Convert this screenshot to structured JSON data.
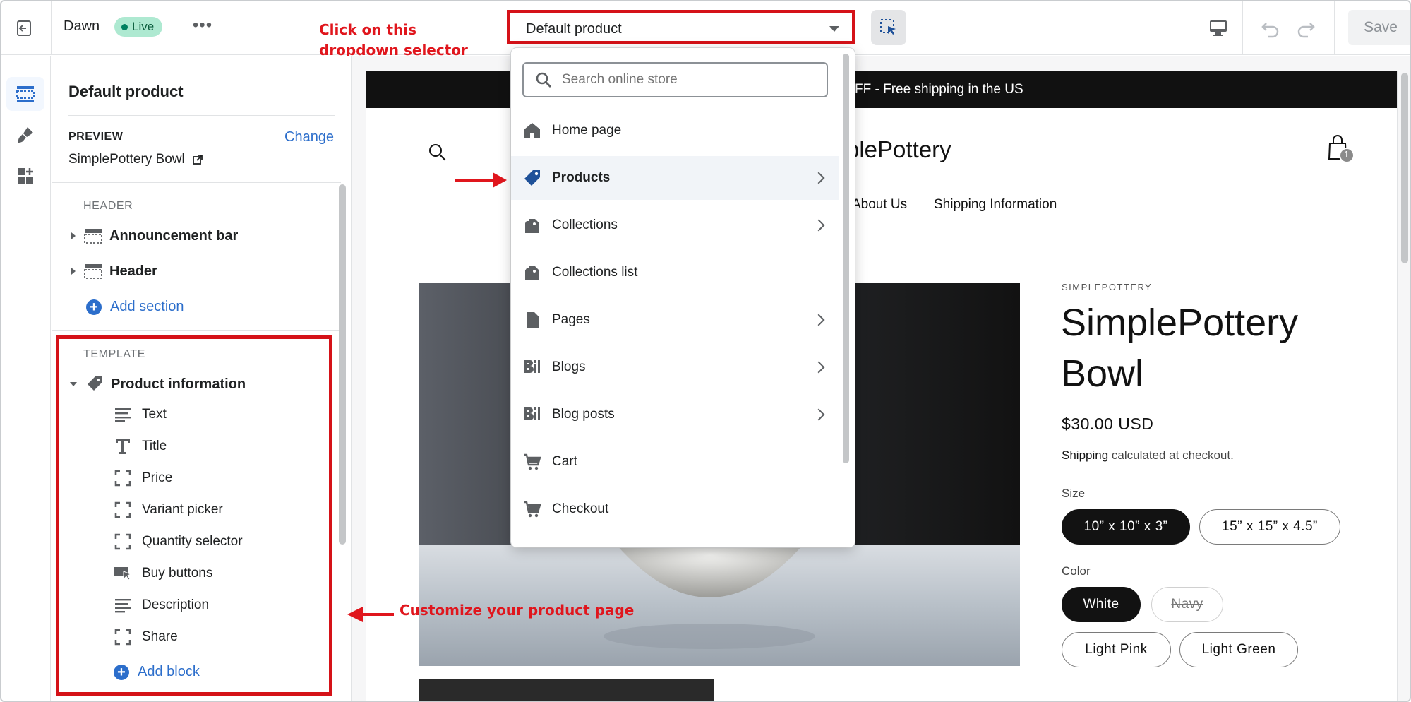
{
  "topbar": {
    "theme_name": "Dawn",
    "status_badge": "Live",
    "template_selector": "Default product",
    "save_label": "Save"
  },
  "annotations": {
    "dropdown_note": "Click on this dropdown selector",
    "sidebar_note": "Customize your product page"
  },
  "sidebar": {
    "title": "Default product",
    "preview_label": "PREVIEW",
    "change_label": "Change",
    "preview_product": "SimplePottery Bowl",
    "header_group": "HEADER",
    "header_sections": [
      "Announcement bar",
      "Header"
    ],
    "add_section": "Add section",
    "template_group": "TEMPLATE",
    "template_section": "Product information",
    "blocks": [
      {
        "label": "Text",
        "icon": "text-lines-icon"
      },
      {
        "label": "Title",
        "icon": "title-t-icon"
      },
      {
        "label": "Price",
        "icon": "dashed-square-icon"
      },
      {
        "label": "Variant picker",
        "icon": "dashed-square-icon"
      },
      {
        "label": "Quantity selector",
        "icon": "dashed-square-icon"
      },
      {
        "label": "Buy buttons",
        "icon": "buy-button-icon"
      },
      {
        "label": "Description",
        "icon": "text-lines-icon"
      },
      {
        "label": "Share",
        "icon": "dashed-square-icon"
      }
    ],
    "add_block": "Add block"
  },
  "dropdown": {
    "search_placeholder": "Search online store",
    "items": [
      {
        "label": "Home page",
        "icon": "home-icon",
        "has_children": false
      },
      {
        "label": "Products",
        "icon": "product-tag-icon",
        "has_children": true,
        "active": true
      },
      {
        "label": "Collections",
        "icon": "collection-icon",
        "has_children": true
      },
      {
        "label": "Collections list",
        "icon": "collection-icon",
        "has_children": false
      },
      {
        "label": "Pages",
        "icon": "page-icon",
        "has_children": true
      },
      {
        "label": "Blogs",
        "icon": "blog-icon",
        "has_children": true
      },
      {
        "label": "Blog posts",
        "icon": "blog-icon",
        "has_children": true
      },
      {
        "label": "Cart",
        "icon": "cart-icon",
        "has_children": false
      },
      {
        "label": "Checkout",
        "icon": "cart-icon",
        "has_children": false
      }
    ]
  },
  "store": {
    "announcement": "FF - Free shipping in the US",
    "logo_text": "plePottery",
    "cart_count": "1",
    "nav": [
      "About Us",
      "Shipping Information"
    ],
    "vendor": "SIMPLEPOTTERY",
    "product_title": "SimplePottery Bowl",
    "price": "$30.00 USD",
    "shipping_link": "Shipping",
    "shipping_rest": " calculated at checkout.",
    "size_label": "Size",
    "sizes": [
      "10” x 10” x 3”",
      "15” x 15” x 4.5”"
    ],
    "color_label": "Color",
    "colors": [
      "White",
      "Navy",
      "Light Pink",
      "Light Green"
    ]
  },
  "colors": {
    "accent_blue": "#2c6ecb",
    "highlight_red": "#d51218",
    "live_green": "#aee9d1"
  }
}
